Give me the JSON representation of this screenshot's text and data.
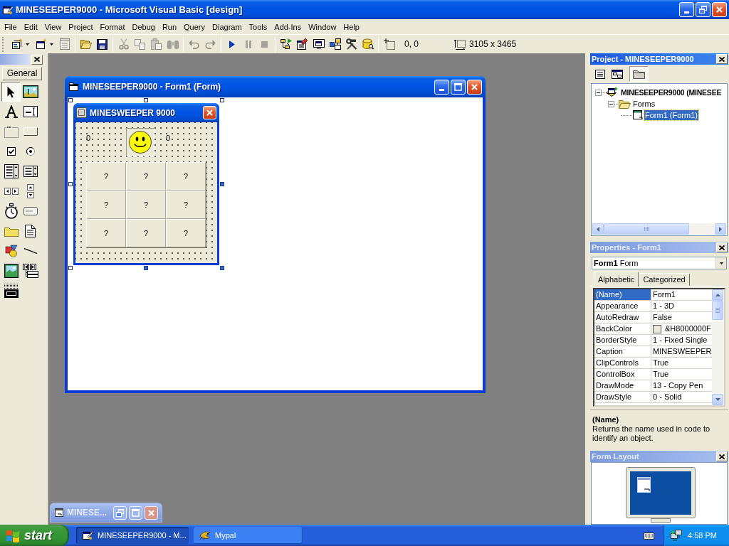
{
  "window": {
    "title": "MINESEEPER9000 - Microsoft Visual Basic [design]"
  },
  "menu": [
    "File",
    "Edit",
    "View",
    "Project",
    "Format",
    "Debug",
    "Run",
    "Query",
    "Diagram",
    "Tools",
    "Add-Ins",
    "Window",
    "Help"
  ],
  "toolbar": {
    "groups": [
      [
        {
          "kind": "add_project",
          "disabled": false,
          "dropdown": true
        },
        {
          "kind": "add_form",
          "disabled": false,
          "dropdown": true
        },
        {
          "kind": "menu_editor",
          "disabled": true
        }
      ],
      [
        {
          "kind": "open",
          "disabled": false
        },
        {
          "kind": "save",
          "disabled": false
        }
      ],
      [
        {
          "kind": "cut",
          "disabled": true
        },
        {
          "kind": "copy",
          "disabled": true
        },
        {
          "kind": "paste",
          "disabled": true
        },
        {
          "kind": "find",
          "disabled": true
        }
      ],
      [
        {
          "kind": "undo",
          "disabled": true
        },
        {
          "kind": "redo",
          "disabled": true
        }
      ],
      [
        {
          "kind": "start",
          "disabled": false
        },
        {
          "kind": "break",
          "disabled": true
        },
        {
          "kind": "end",
          "disabled": true
        }
      ],
      [
        {
          "kind": "project_explorer",
          "disabled": false
        },
        {
          "kind": "properties_window",
          "disabled": false
        },
        {
          "kind": "form_layout",
          "disabled": false
        },
        {
          "kind": "object_browser",
          "disabled": false
        },
        {
          "kind": "toolbox",
          "disabled": false
        },
        {
          "kind": "data_view",
          "disabled": false
        }
      ]
    ],
    "position": "0, 0",
    "size": "3105 x 3465"
  },
  "toolbox": {
    "tab": "General",
    "tools": [
      {
        "kind": "pointer",
        "selected": true
      },
      {
        "kind": "picture_box",
        "selected": false
      },
      {
        "kind": "label",
        "selected": false
      },
      {
        "kind": "text_box",
        "selected": false
      },
      {
        "kind": "frame",
        "selected": false
      },
      {
        "kind": "command_button",
        "selected": false
      },
      {
        "kind": "check_box",
        "selected": false
      },
      {
        "kind": "option_button",
        "selected": false
      },
      {
        "kind": "combo_box",
        "selected": false
      },
      {
        "kind": "list_box",
        "selected": false
      },
      {
        "kind": "hscroll",
        "selected": false
      },
      {
        "kind": "vscroll",
        "selected": false
      },
      {
        "kind": "timer",
        "selected": false
      },
      {
        "kind": "drive_list",
        "selected": false
      },
      {
        "kind": "dir_list",
        "selected": false
      },
      {
        "kind": "file_list",
        "selected": false
      },
      {
        "kind": "shape",
        "selected": false
      },
      {
        "kind": "line",
        "selected": false
      },
      {
        "kind": "image",
        "selected": false
      },
      {
        "kind": "data",
        "selected": false
      },
      {
        "kind": "ole",
        "selected": false
      }
    ]
  },
  "designer": {
    "title": "MINESEEPER9000 - Form1 (Form)",
    "active": true,
    "form": {
      "title": "MINESWEEPER 9000",
      "counters": [
        "0",
        "0"
      ],
      "cells": [
        "?",
        "?",
        "?",
        "?",
        "?",
        "?",
        "?",
        "?",
        "?"
      ]
    }
  },
  "minimized_window": {
    "title": "MINESE...",
    "active": false
  },
  "project": {
    "title": "Project - MINESEEPER9000",
    "active": true,
    "toolbar": [
      {
        "kind": "view_code",
        "pressed": false
      },
      {
        "kind": "view_object",
        "pressed": false
      },
      {
        "kind": "toggle_folders",
        "pressed": true
      }
    ],
    "tree": [
      {
        "label": "MINESEEPER9000 (MINESEE",
        "kind": "project",
        "expanded": true,
        "selected": false,
        "children": [
          {
            "label": "Forms",
            "kind": "folder",
            "expanded": true,
            "selected": false,
            "children": [
              {
                "label": "Form1 (Form1)",
                "kind": "form",
                "selected": true
              }
            ]
          }
        ]
      }
    ]
  },
  "properties": {
    "title": "Properties - Form1",
    "active": false,
    "object": {
      "name": "Form1",
      "type": "Form"
    },
    "tabs": [
      {
        "label": "Alphabetic",
        "selected": true
      },
      {
        "label": "Categorized",
        "selected": false
      }
    ],
    "rows": [
      {
        "name": "(Name)",
        "value": "Form1",
        "kind": "text",
        "selected": true
      },
      {
        "name": "Appearance",
        "value": "1 - 3D",
        "kind": "text",
        "selected": false
      },
      {
        "name": "AutoRedraw",
        "value": "False",
        "kind": "text",
        "selected": false
      },
      {
        "name": "BackColor",
        "value": "&H8000000F",
        "kind": "color",
        "selected": false
      },
      {
        "name": "BorderStyle",
        "value": "1 - Fixed Single",
        "kind": "text",
        "selected": false
      },
      {
        "name": "Caption",
        "value": "MINESWEEPER",
        "kind": "text",
        "selected": false
      },
      {
        "name": "ClipControls",
        "value": "True",
        "kind": "text",
        "selected": false
      },
      {
        "name": "ControlBox",
        "value": "True",
        "kind": "text",
        "selected": false
      },
      {
        "name": "DrawMode",
        "value": "13 - Copy Pen",
        "kind": "text",
        "selected": false
      },
      {
        "name": "DrawStyle",
        "value": "0 - Solid",
        "kind": "text",
        "selected": false
      }
    ],
    "description": {
      "title": "(Name)",
      "text": "Returns the name used in code to identify an object."
    }
  },
  "form_layout": {
    "title": "Form Layout",
    "active": false
  },
  "taskbar": {
    "start": "start",
    "items": [
      {
        "label": "MINESEEPER9000 - M...",
        "selected": true
      },
      {
        "label": "Mypal",
        "selected": false
      }
    ],
    "clock": "4:58 PM"
  }
}
